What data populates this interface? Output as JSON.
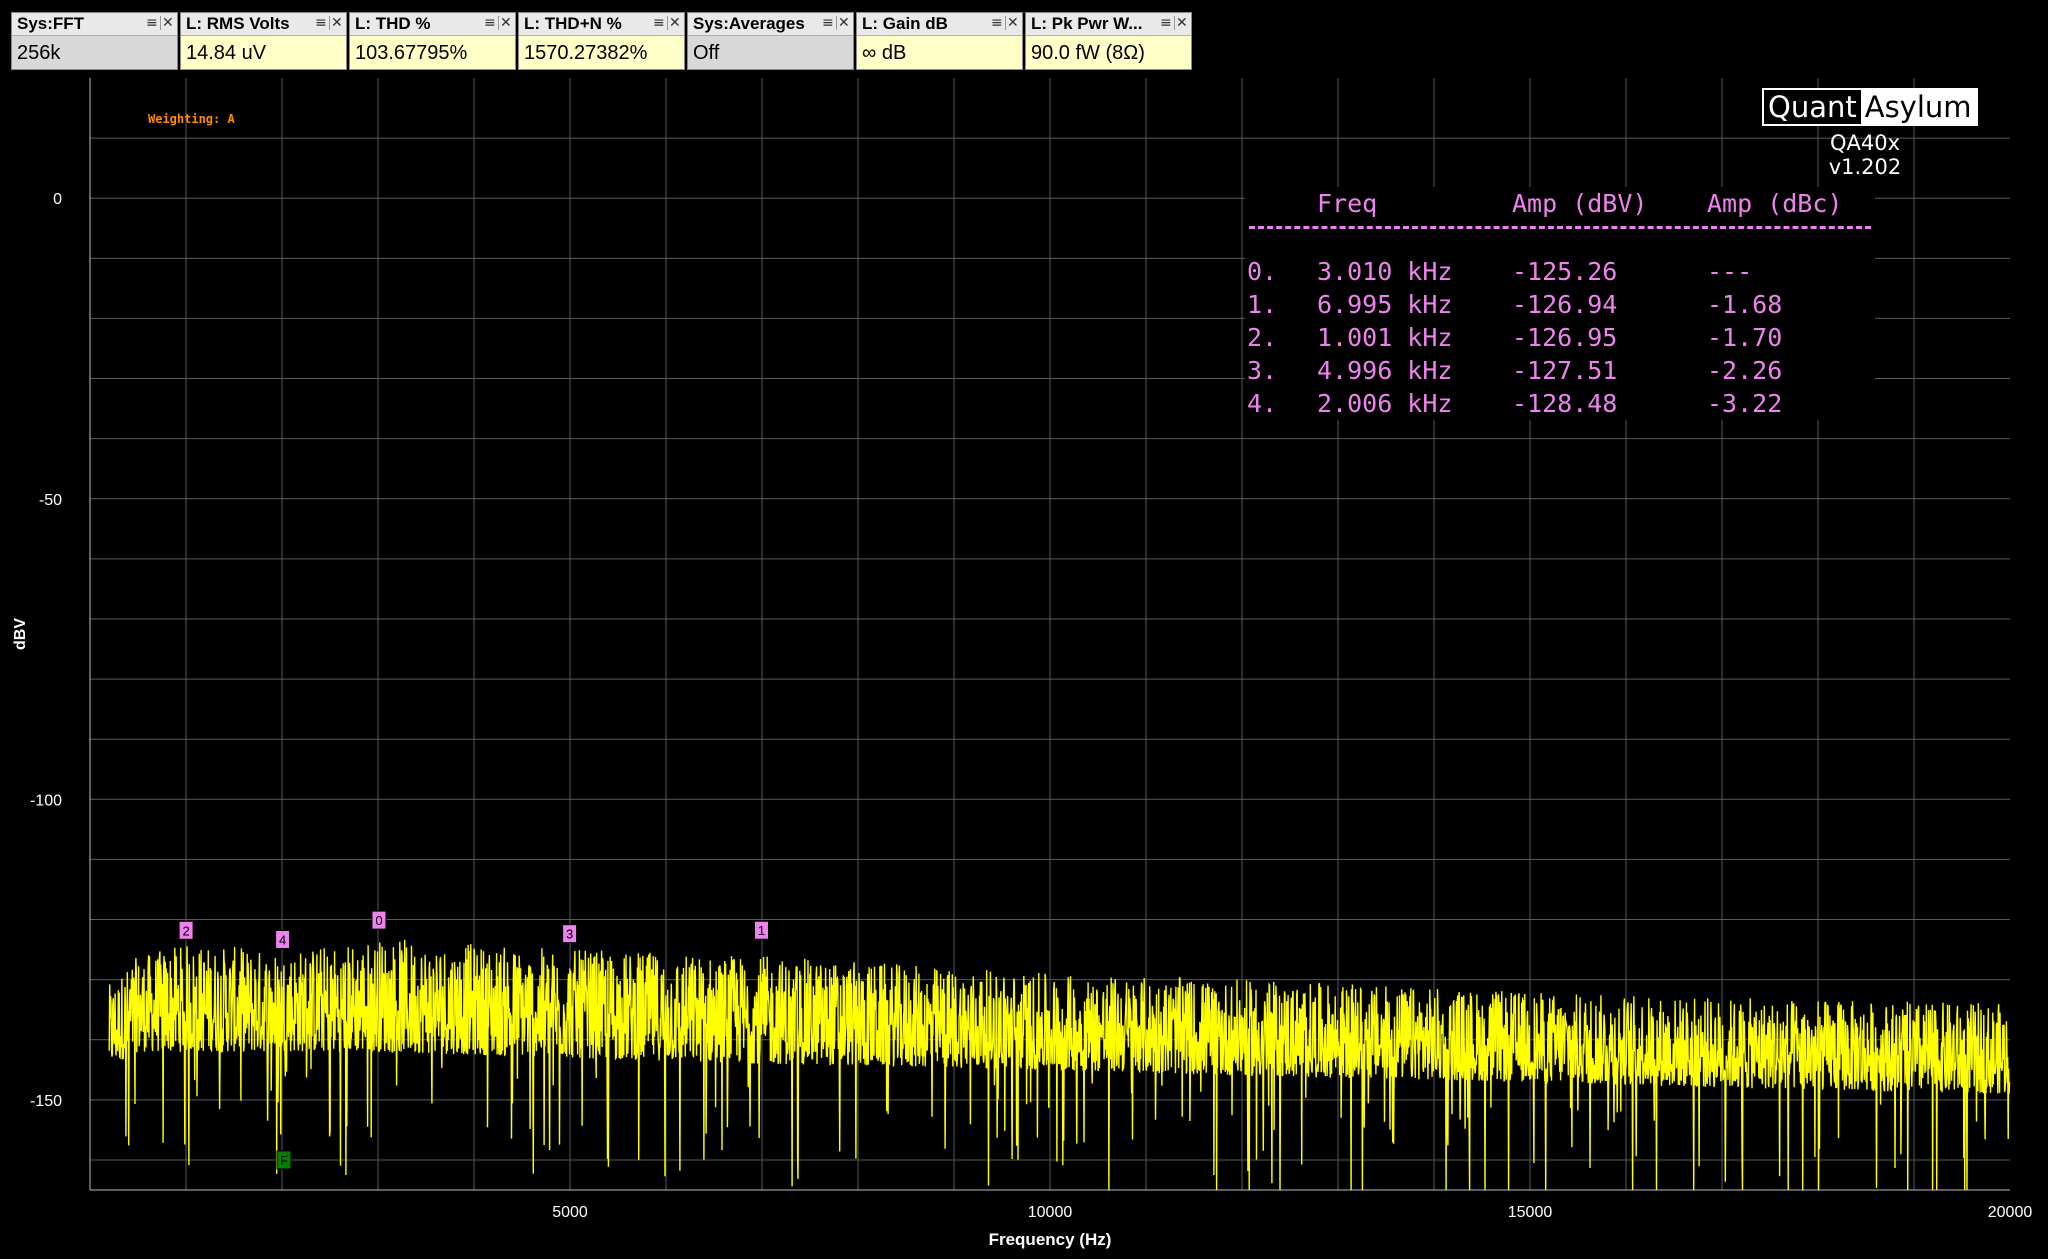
{
  "widgets": [
    {
      "title": "Sys:FFT",
      "value": "256k",
      "style": "gray"
    },
    {
      "title": "L: RMS Volts",
      "value": "14.84 uV",
      "style": "yellow"
    },
    {
      "title": "L: THD %",
      "value": "103.67795%",
      "style": "yellow"
    },
    {
      "title": "L: THD+N %",
      "value": "1570.27382%",
      "style": "yellow"
    },
    {
      "title": "Sys:Averages",
      "value": "Off",
      "style": "gray"
    },
    {
      "title": "L: Gain dB",
      "value": "∞ dB",
      "style": "yellow"
    },
    {
      "title": "L: Pk Pwr W...",
      "value": "90.0 fW (8Ω)",
      "style": "yellow"
    }
  ],
  "widget_icons": {
    "menu": "menu-icon",
    "close": "close-icon"
  },
  "logo": {
    "left": "Quant",
    "right": "Asylum",
    "version": "QA40x v1.202"
  },
  "marker_table": {
    "headers": [
      "Freq",
      "Amp (dBV)",
      "Amp (dBc)"
    ],
    "rows": [
      {
        "index": "0.",
        "freq": "3.010 kHz",
        "amp_dbv": "-125.26",
        "amp_dbc": "---"
      },
      {
        "index": "1.",
        "freq": "6.995 kHz",
        "amp_dbv": "-126.94",
        "amp_dbc": "-1.68"
      },
      {
        "index": "2.",
        "freq": "1.001 kHz",
        "amp_dbv": "-126.95",
        "amp_dbc": "-1.70"
      },
      {
        "index": "3.",
        "freq": "4.996 kHz",
        "amp_dbv": "-127.51",
        "amp_dbc": "-2.26"
      },
      {
        "index": "4.",
        "freq": "2.006 kHz",
        "amp_dbv": "-128.48",
        "amp_dbc": "-3.22"
      }
    ]
  },
  "chart_data": {
    "type": "line",
    "title": "",
    "annotation": "Weighting: A",
    "xlabel": "Frequency (Hz)",
    "ylabel": "dBV",
    "xlim": [
      0,
      20000
    ],
    "ylim": [
      -165,
      20
    ],
    "x_ticks": [
      5000,
      10000,
      15000,
      20000
    ],
    "y_ticks": [
      0,
      -50,
      -100,
      -150
    ],
    "grid": true,
    "series": [
      {
        "color": "#ffff00",
        "style": "dense noise floor",
        "envelope": {
          "x": [
            0,
            500,
            1000,
            2000,
            3000,
            5000,
            7000,
            10000,
            12000,
            15000,
            17000,
            20000
          ],
          "peak": [
            -134,
            -126,
            -124,
            -125,
            -123,
            -125,
            -126,
            -129,
            -130,
            -132,
            -133,
            -134
          ],
          "median": [
            -140,
            -136,
            -136,
            -136,
            -136,
            -137,
            -138,
            -139,
            -140,
            -141,
            -142,
            -143
          ]
        }
      }
    ],
    "markers": [
      {
        "label": "0",
        "x": 3010,
        "y": -125.26,
        "color": "#ee82ee"
      },
      {
        "label": "1",
        "x": 6995,
        "y": -126.94,
        "color": "#ee82ee"
      },
      {
        "label": "2",
        "x": 1001,
        "y": -126.95,
        "color": "#ee82ee"
      },
      {
        "label": "3",
        "x": 4996,
        "y": -127.51,
        "color": "#ee82ee"
      },
      {
        "label": "4",
        "x": 2006,
        "y": -128.48,
        "color": "#ee82ee"
      },
      {
        "label": "F",
        "x": 2020,
        "y": -160,
        "color": "#008000"
      }
    ],
    "colors": {
      "grid": "#5a5a5a",
      "axes_text": "#ffffff",
      "annotation": "#ff8c00"
    }
  }
}
